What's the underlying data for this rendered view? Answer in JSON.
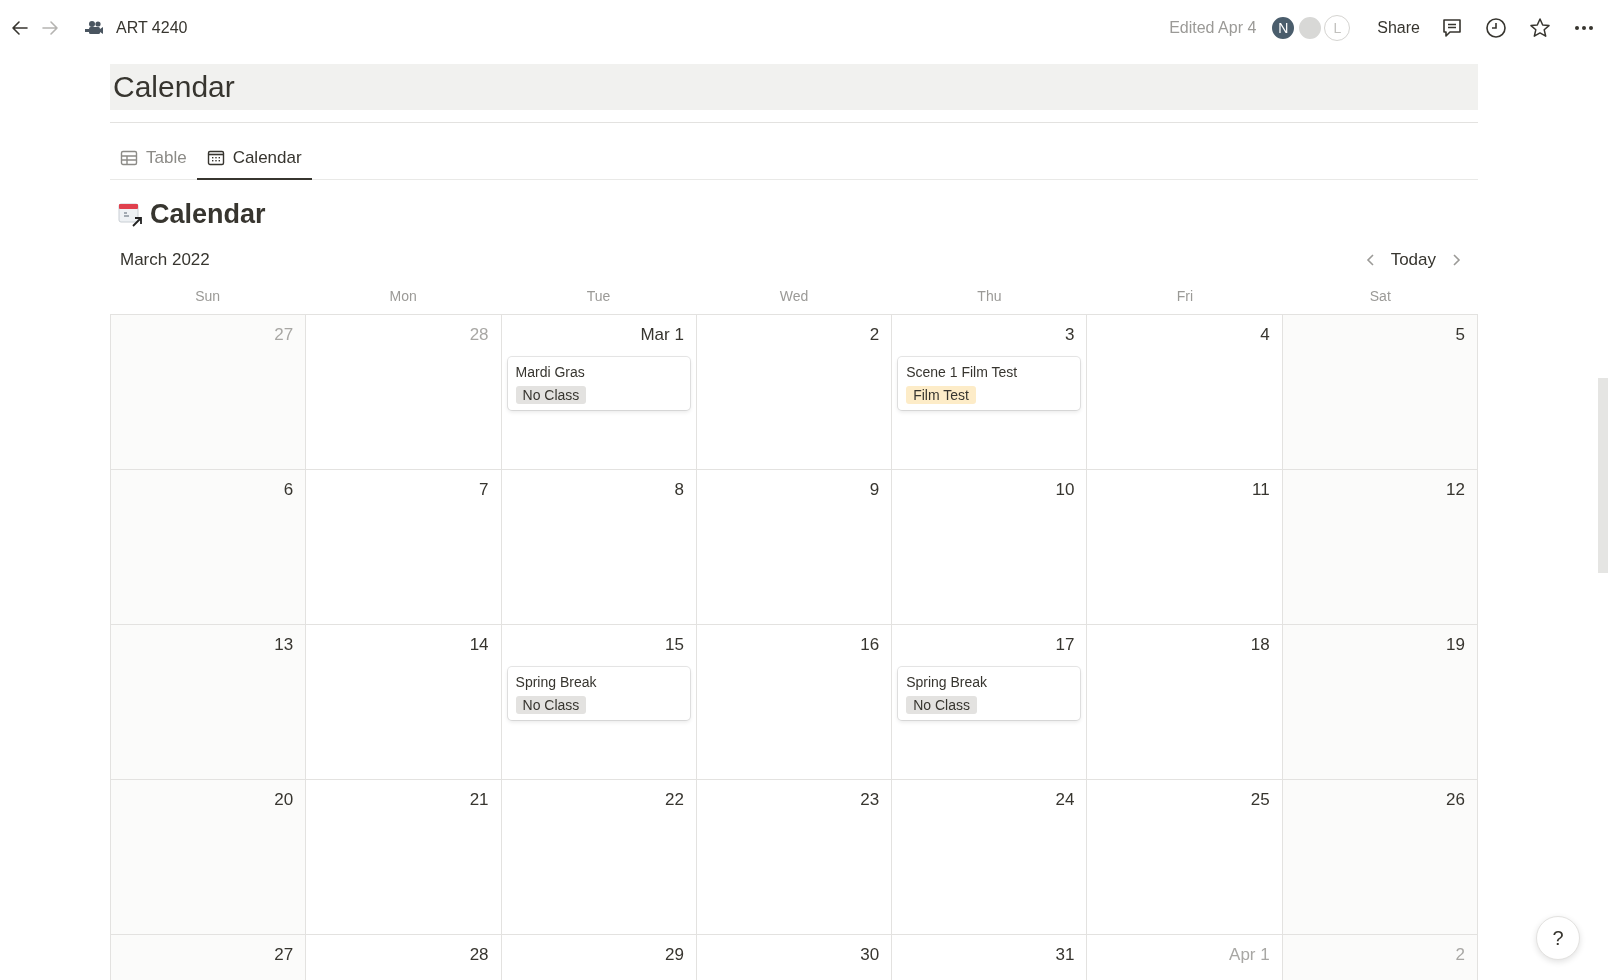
{
  "topbar": {
    "back": {
      "disabled": false
    },
    "forward": {
      "disabled": true
    },
    "page_title": "ART 4240",
    "edited": "Edited Apr 4",
    "avatars": [
      {
        "kind": "initial",
        "initial": "N"
      },
      {
        "kind": "photo"
      },
      {
        "kind": "outline",
        "initial": "L"
      }
    ],
    "share": "Share"
  },
  "page_heading": "Calendar",
  "tabs": [
    {
      "label": "Table",
      "kind": "table",
      "selected": false
    },
    {
      "label": "Calendar",
      "kind": "calendar",
      "selected": true
    }
  ],
  "view_title": "Calendar",
  "month": "March 2022",
  "today": "Today",
  "weekdays": [
    "Sun",
    "Mon",
    "Tue",
    "Wed",
    "Thu",
    "Fri",
    "Sat"
  ],
  "weeks": [
    [
      {
        "day": "27",
        "in_month": false
      },
      {
        "day": "28",
        "in_month": false
      },
      {
        "day": "Mar 1",
        "in_month": true,
        "events": [
          {
            "title": "Mardi Gras",
            "tag": {
              "label": "No Class",
              "color": "#e3e2e0"
            }
          }
        ]
      },
      {
        "day": "2",
        "in_month": true
      },
      {
        "day": "3",
        "in_month": true,
        "events": [
          {
            "title": "Scene 1 Film Test",
            "tag": {
              "label": "Film Test",
              "color": "#fdecc8"
            }
          }
        ]
      },
      {
        "day": "4",
        "in_month": true
      },
      {
        "day": "5",
        "in_month": true
      }
    ],
    [
      {
        "day": "6",
        "in_month": true
      },
      {
        "day": "7",
        "in_month": true
      },
      {
        "day": "8",
        "in_month": true
      },
      {
        "day": "9",
        "in_month": true
      },
      {
        "day": "10",
        "in_month": true
      },
      {
        "day": "11",
        "in_month": true
      },
      {
        "day": "12",
        "in_month": true
      }
    ],
    [
      {
        "day": "13",
        "in_month": true
      },
      {
        "day": "14",
        "in_month": true
      },
      {
        "day": "15",
        "in_month": true,
        "events": [
          {
            "title": "Spring Break",
            "tag": {
              "label": "No Class",
              "color": "#e3e2e0"
            }
          }
        ]
      },
      {
        "day": "16",
        "in_month": true
      },
      {
        "day": "17",
        "in_month": true,
        "events": [
          {
            "title": "Spring Break",
            "tag": {
              "label": "No Class",
              "color": "#e3e2e0"
            }
          }
        ]
      },
      {
        "day": "18",
        "in_month": true
      },
      {
        "day": "19",
        "in_month": true
      }
    ],
    [
      {
        "day": "20",
        "in_month": true
      },
      {
        "day": "21",
        "in_month": true
      },
      {
        "day": "22",
        "in_month": true
      },
      {
        "day": "23",
        "in_month": true
      },
      {
        "day": "24",
        "in_month": true
      },
      {
        "day": "25",
        "in_month": true
      },
      {
        "day": "26",
        "in_month": true
      }
    ],
    [
      {
        "day": "27",
        "in_month": true
      },
      {
        "day": "28",
        "in_month": true
      },
      {
        "day": "29",
        "in_month": true
      },
      {
        "day": "30",
        "in_month": true
      },
      {
        "day": "31",
        "in_month": true
      },
      {
        "day": "Apr 1",
        "in_month": false
      },
      {
        "day": "2",
        "in_month": false
      }
    ]
  ],
  "help": "?"
}
